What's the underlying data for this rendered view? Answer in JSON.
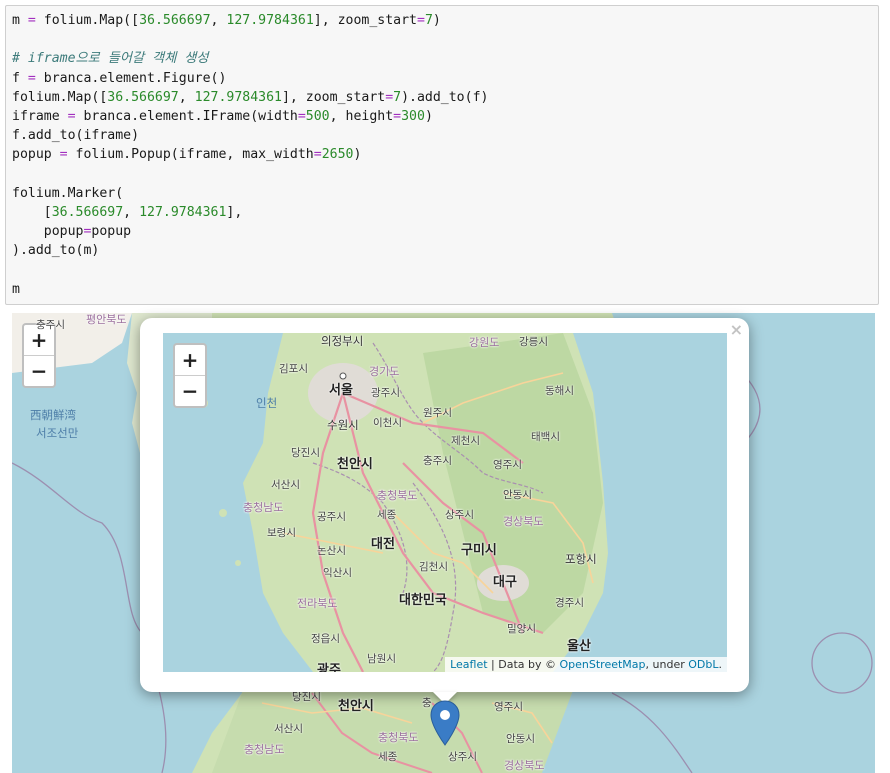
{
  "code": {
    "lines": [
      [
        {
          "t": "m "
        },
        {
          "t": "=",
          "c": "op"
        },
        {
          "t": " folium.Map(["
        },
        {
          "t": "36.566697",
          "c": "n"
        },
        {
          "t": ", "
        },
        {
          "t": "127.9784361",
          "c": "n"
        },
        {
          "t": "], zoom_start"
        },
        {
          "t": "=",
          "c": "op"
        },
        {
          "t": "7",
          "c": "n"
        },
        {
          "t": ")"
        }
      ],
      [],
      [
        {
          "t": "# iframe으로 들어갈 객체 생성",
          "c": "cm"
        }
      ],
      [
        {
          "t": "f "
        },
        {
          "t": "=",
          "c": "op"
        },
        {
          "t": " branca.element.Figure()"
        }
      ],
      [
        {
          "t": "folium.Map(["
        },
        {
          "t": "36.566697",
          "c": "n"
        },
        {
          "t": ", "
        },
        {
          "t": "127.9784361",
          "c": "n"
        },
        {
          "t": "], zoom_start"
        },
        {
          "t": "=",
          "c": "op"
        },
        {
          "t": "7",
          "c": "n"
        },
        {
          "t": ").add_to(f)"
        }
      ],
      [
        {
          "t": "iframe "
        },
        {
          "t": "=",
          "c": "op"
        },
        {
          "t": " branca.element.IFrame(width"
        },
        {
          "t": "=",
          "c": "op"
        },
        {
          "t": "500",
          "c": "n"
        },
        {
          "t": ", height"
        },
        {
          "t": "=",
          "c": "op"
        },
        {
          "t": "300",
          "c": "n"
        },
        {
          "t": ")"
        }
      ],
      [
        {
          "t": "f.add_to(iframe)"
        }
      ],
      [
        {
          "t": "popup "
        },
        {
          "t": "=",
          "c": "op"
        },
        {
          "t": " folium.Popup(iframe, max_width"
        },
        {
          "t": "=",
          "c": "op"
        },
        {
          "t": "2650",
          "c": "n"
        },
        {
          "t": ")"
        }
      ],
      [],
      [
        {
          "t": "folium.Marker("
        }
      ],
      [
        {
          "t": "    ["
        },
        {
          "t": "36.566697",
          "c": "n"
        },
        {
          "t": ", "
        },
        {
          "t": "127.9784361",
          "c": "n"
        },
        {
          "t": "],"
        }
      ],
      [
        {
          "t": "    popup"
        },
        {
          "t": "=",
          "c": "op"
        },
        {
          "t": "popup"
        }
      ],
      [
        {
          "t": ").add_to(m)"
        }
      ],
      [],
      [
        {
          "t": "m"
        }
      ]
    ]
  },
  "outer_map": {
    "zoom_in": "+",
    "zoom_out": "−",
    "labels": {
      "top_left": "충주시",
      "pyeongbuk": "평안북도",
      "sea_west_1": "西朝鮮湾",
      "sea_west_2": "서조선만",
      "cheonan": "천안시",
      "chungbuk": "충청북도",
      "chungnam": "충청남도",
      "seosan": "서산시",
      "dangjin": "당진시",
      "yeongju": "영주시",
      "andong": "안동시",
      "sangju": "상주시",
      "gyeongbuk": "경상북도",
      "sejong": "세종",
      "chung_short": "충"
    }
  },
  "popup": {
    "close": "×",
    "zoom_in": "+",
    "zoom_out": "−",
    "labels": {
      "uijeongbu": "의정부시",
      "gangwon": "강원도",
      "gangneung": "강릉시",
      "gimpo": "김포시",
      "seoul": "서울",
      "gyeonggi": "경기도",
      "incheon": "인천",
      "gwangju_gg": "광주시",
      "donghae": "동해시",
      "wonju": "원주시",
      "suwon": "수원시",
      "icheon": "이천시",
      "jecheon": "제천시",
      "taebaek": "태백시",
      "dangjin": "당진시",
      "cheonan": "천안시",
      "chungju": "충주시",
      "yeongju": "영주시",
      "seosan": "서산시",
      "chungbuk": "충청북도",
      "andong": "안동시",
      "chungnam": "충청남도",
      "gongju": "공주시",
      "sejong": "세종",
      "sangju": "상주시",
      "gyeongbuk": "경상북도",
      "boryeong": "보령시",
      "daejeon": "대전",
      "gumi": "구미시",
      "pohang": "포항시",
      "nonsan": "논산시",
      "gimcheon": "김천시",
      "iksan": "익산시",
      "daegu": "대구",
      "jeonbuk": "전라북도",
      "korea": "대한민국",
      "gyeongju": "경주시",
      "miryang": "밀양시",
      "jeongeup": "정읍시",
      "ulsan": "울산",
      "namwon": "남원시",
      "gwangju": "광주"
    },
    "attribution": {
      "leaflet": "Leaflet",
      "sep": " | Data by © ",
      "osm": "OpenStreetMap",
      "under": ", under ",
      "odbl": "ODbL",
      "end": "."
    }
  },
  "marker": {
    "icon": "map-marker-icon",
    "color": "#3a7cc6"
  }
}
